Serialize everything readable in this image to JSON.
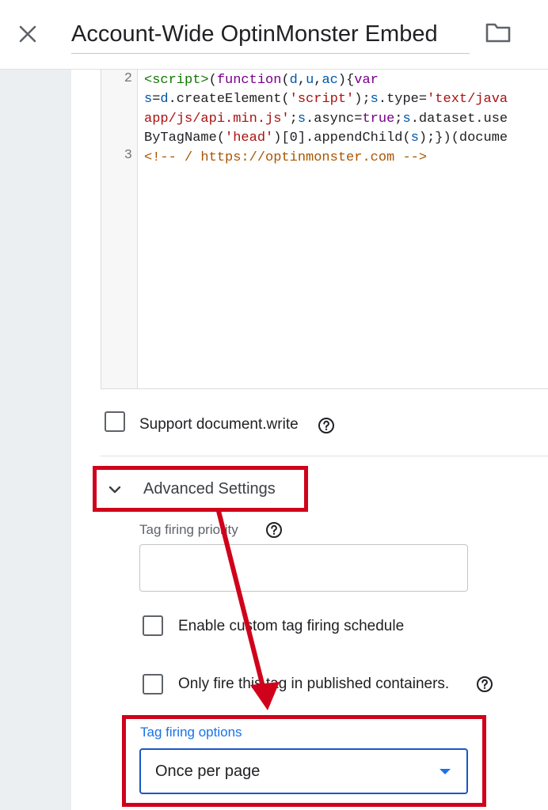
{
  "header": {
    "title": "Account-Wide OptinMonster Embed",
    "close_icon": "close-icon",
    "folder_icon": "folder-icon"
  },
  "editor": {
    "lines": [
      {
        "number": "2"
      },
      {
        "number": ""
      },
      {
        "number": ""
      },
      {
        "number": ""
      },
      {
        "number": "3"
      }
    ],
    "code_line_1_parts": [
      "<script>",
      "(",
      "function",
      "(",
      "d",
      ",",
      "u",
      ",",
      "ac",
      "){",
      "var"
    ],
    "code_line_2_parts": [
      "s",
      "=",
      "d",
      ".createElement(",
      "'script'",
      ");",
      "s",
      ".type=",
      "'text/java"
    ],
    "code_line_3_parts": [
      "app/js/api.min.js'",
      ";",
      "s",
      ".async=",
      "true",
      ";",
      "s",
      ".dataset.use"
    ],
    "code_line_4_parts": [
      "ByTagName(",
      "'head'",
      ")[0].appendChild(",
      "s",
      ");})(docume"
    ],
    "code_line_5": "<!-- / https://optinmonster.com -->"
  },
  "support_document_write": {
    "label": "Support document.write",
    "checked": false,
    "help_icon": "help-icon"
  },
  "advanced_settings": {
    "label": "Advanced Settings",
    "expanded": true,
    "tag_firing_priority": {
      "label": "Tag firing priority",
      "value": "",
      "help_icon": "help-icon"
    },
    "enable_custom_schedule": {
      "label": "Enable custom tag firing schedule",
      "checked": false
    },
    "only_fire_published": {
      "label": "Only fire this tag in published containers.",
      "checked": false,
      "help_icon": "help-icon"
    },
    "tag_firing_options": {
      "label": "Tag firing options",
      "selected": "Once per page"
    }
  },
  "annotation": {
    "highlight_color": "#d0021b"
  }
}
